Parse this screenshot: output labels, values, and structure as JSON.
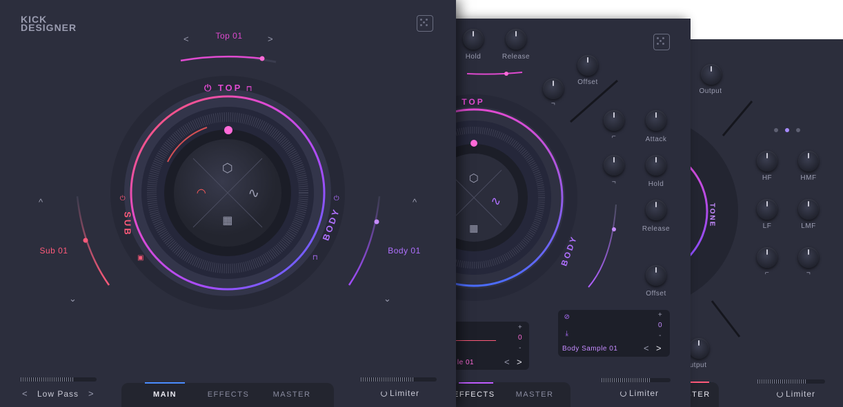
{
  "colors": {
    "accent_pink": "#e04ad0",
    "accent_purple": "#a24dff",
    "accent_red": "#ff5a5a",
    "accent_blue": "#4a6cff",
    "panel_bg": "#2c2e3d"
  },
  "main": {
    "logo_line1": "KICK",
    "logo_line2": "DESIGNER",
    "top_preset": "Top 01",
    "sub_preset": "Sub 01",
    "body_preset": "Body 01",
    "ring_top": "TOP",
    "ring_sub": "SUB",
    "ring_body": "BODY",
    "filter_label": "Low Pass",
    "prev_arrow": "<",
    "next_arrow": ">",
    "limiter_label": "Limiter",
    "tabs": [
      {
        "label": "MAIN",
        "active": true
      },
      {
        "label": "EFFECTS",
        "active": false
      },
      {
        "label": "MASTER",
        "active": false
      }
    ]
  },
  "effects": {
    "hold": "Hold",
    "release": "Release",
    "offset": "Offset",
    "attack2": "Attack",
    "hold2": "Hold",
    "release2": "Release",
    "offset2": "Offset",
    "ring_top": "TOP",
    "ring_body": "BODY",
    "sub_sample": "le 01",
    "sub_value": "0",
    "plus": "+",
    "minus": "-",
    "body_sample": "Body Sample 01",
    "body_value": "0",
    "prev": "<",
    "next": ">",
    "limiter_label": "Limiter",
    "tabs": [
      {
        "label": "EFFECTS",
        "active": true
      },
      {
        "label": "MASTER",
        "active": false
      }
    ]
  },
  "master": {
    "output_top": "Output",
    "output_bottom": "utput",
    "hf": "HF",
    "hmf": "HMF",
    "lf": "LF",
    "lmf": "LMF",
    "ring_tone": "TONE",
    "tab_label": "STER",
    "limiter_label": "Limiter"
  }
}
